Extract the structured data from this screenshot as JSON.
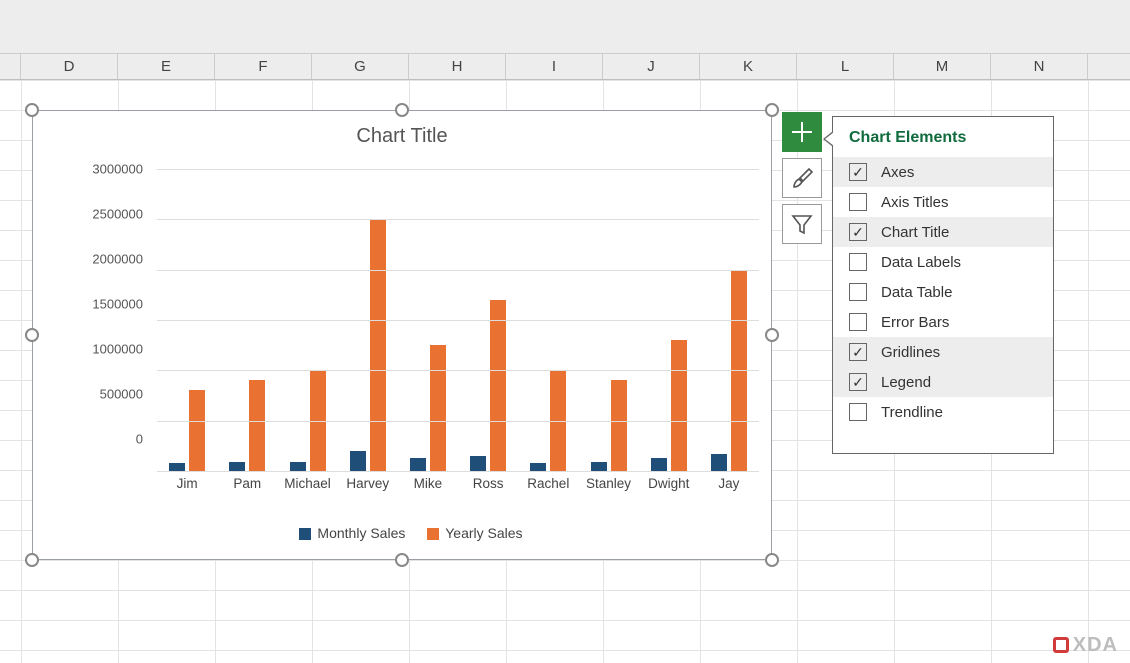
{
  "columns": [
    "D",
    "E",
    "F",
    "G",
    "H",
    "I",
    "J",
    "K",
    "L",
    "M",
    "N"
  ],
  "chart": {
    "title": "Chart Title"
  },
  "legend": {
    "series1": "Monthly Sales",
    "series2": "Yearly Sales"
  },
  "callout": {
    "title": "Chart Elements",
    "items": [
      {
        "label": "Axes",
        "checked": true,
        "hl": true
      },
      {
        "label": "Axis Titles",
        "checked": false,
        "hl": false
      },
      {
        "label": "Chart Title",
        "checked": true,
        "hl": true
      },
      {
        "label": "Data Labels",
        "checked": false,
        "hl": false
      },
      {
        "label": "Data Table",
        "checked": false,
        "hl": false
      },
      {
        "label": "Error Bars",
        "checked": false,
        "hl": false
      },
      {
        "label": "Gridlines",
        "checked": true,
        "hl": true
      },
      {
        "label": "Legend",
        "checked": true,
        "hl": true
      },
      {
        "label": "Trendline",
        "checked": false,
        "hl": false
      }
    ]
  },
  "chart_data": {
    "type": "bar",
    "title": "Chart Title",
    "xlabel": "",
    "ylabel": "",
    "ylim": [
      0,
      3000000
    ],
    "yticks": [
      0,
      500000,
      1000000,
      1500000,
      2000000,
      2500000,
      3000000
    ],
    "categories": [
      "Jim",
      "Pam",
      "Michael",
      "Harvey",
      "Mike",
      "Ross",
      "Rachel",
      "Stanley",
      "Dwight",
      "Jay"
    ],
    "series": [
      {
        "name": "Monthly Sales",
        "color": "#1f4e79",
        "values": [
          80000,
          90000,
          85000,
          200000,
          130000,
          150000,
          80000,
          90000,
          130000,
          170000
        ]
      },
      {
        "name": "Yearly Sales",
        "color": "#e97132",
        "values": [
          800000,
          900000,
          1000000,
          2500000,
          1250000,
          1700000,
          1000000,
          900000,
          1300000,
          2000000
        ]
      }
    ],
    "legend_position": "bottom",
    "grid": true
  },
  "watermark": "XDA"
}
